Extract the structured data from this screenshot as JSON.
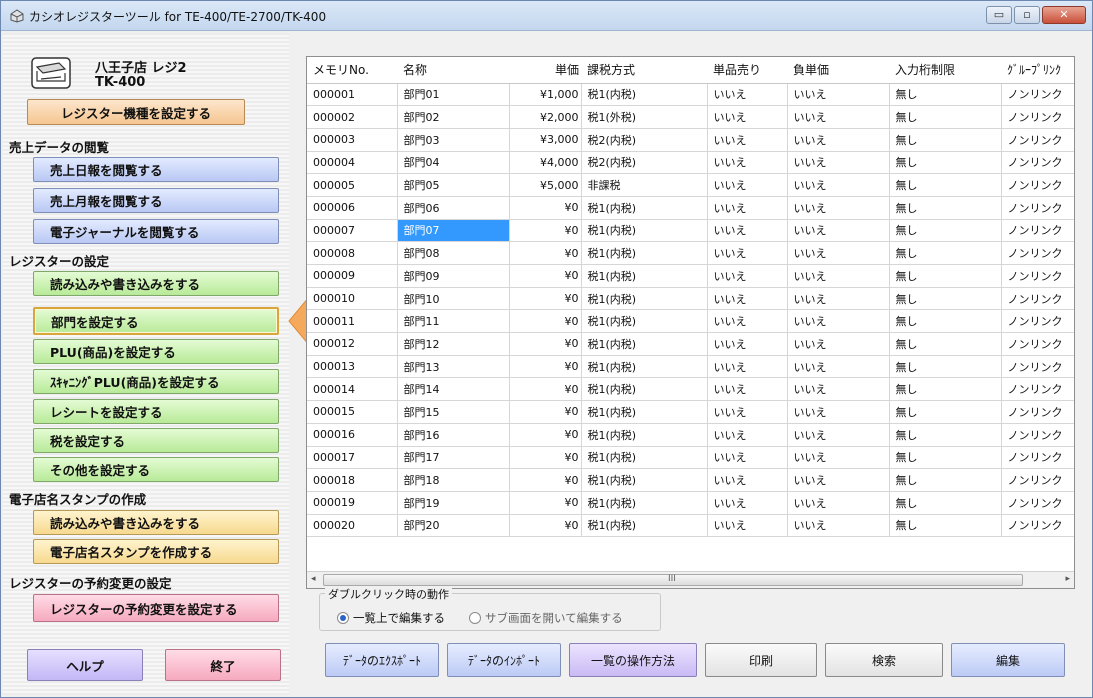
{
  "window": {
    "title": "カシオレジスターツール for TE-400/TE-2700/TK-400",
    "controls": {
      "minimize": "▭",
      "maximize": "▫",
      "close": "✕"
    }
  },
  "sidebar": {
    "register_name": "八王子店 レジ2",
    "register_model": "TK-400",
    "set_model_button": "レジスター機種を設定する",
    "sections": {
      "sales_view": {
        "title": "売上データの閲覧",
        "buttons": [
          "売上日報を閲覧する",
          "売上月報を閲覧する",
          "電子ジャーナルを閲覧する"
        ]
      },
      "register_settings": {
        "title": "レジスターの設定",
        "buttons": [
          "読み込みや書き込みをする",
          "部門を設定する",
          "PLU(商品)を設定する",
          "ｽｷｬﾆﾝｸﾞPLU(商品)を設定する",
          "レシートを設定する",
          "税を設定する",
          "その他を設定する"
        ],
        "selected_index": 1
      },
      "stamp": {
        "title": "電子店名スタンプの作成",
        "buttons": [
          "読み込みや書き込みをする",
          "電子店名スタンプを作成する"
        ]
      },
      "reservation": {
        "title": "レジスターの予約変更の設定",
        "buttons": [
          "レジスターの予約変更を設定する"
        ]
      }
    },
    "help_button": "ヘルプ",
    "exit_button": "終了"
  },
  "table": {
    "columns": [
      "メモリNo.",
      "名称",
      "単価",
      "課税方式",
      "単品売り",
      "負単価",
      "入力桁制限",
      "ｸﾞﾙｰﾌﾟﾘﾝｸ"
    ],
    "selected_cell": {
      "row": 6,
      "col": 1
    },
    "rows": [
      [
        "000001",
        "部門01",
        "¥1,000",
        "税1(内税)",
        "いいえ",
        "いいえ",
        "無し",
        "ノンリンク"
      ],
      [
        "000002",
        "部門02",
        "¥2,000",
        "税1(外税)",
        "いいえ",
        "いいえ",
        "無し",
        "ノンリンク"
      ],
      [
        "000003",
        "部門03",
        "¥3,000",
        "税2(内税)",
        "いいえ",
        "いいえ",
        "無し",
        "ノンリンク"
      ],
      [
        "000004",
        "部門04",
        "¥4,000",
        "税2(内税)",
        "いいえ",
        "いいえ",
        "無し",
        "ノンリンク"
      ],
      [
        "000005",
        "部門05",
        "¥5,000",
        "非課税",
        "いいえ",
        "いいえ",
        "無し",
        "ノンリンク"
      ],
      [
        "000006",
        "部門06",
        "¥0",
        "税1(内税)",
        "いいえ",
        "いいえ",
        "無し",
        "ノンリンク"
      ],
      [
        "000007",
        "部門07",
        "¥0",
        "税1(内税)",
        "いいえ",
        "いいえ",
        "無し",
        "ノンリンク"
      ],
      [
        "000008",
        "部門08",
        "¥0",
        "税1(内税)",
        "いいえ",
        "いいえ",
        "無し",
        "ノンリンク"
      ],
      [
        "000009",
        "部門09",
        "¥0",
        "税1(内税)",
        "いいえ",
        "いいえ",
        "無し",
        "ノンリンク"
      ],
      [
        "000010",
        "部門10",
        "¥0",
        "税1(内税)",
        "いいえ",
        "いいえ",
        "無し",
        "ノンリンク"
      ],
      [
        "000011",
        "部門11",
        "¥0",
        "税1(内税)",
        "いいえ",
        "いいえ",
        "無し",
        "ノンリンク"
      ],
      [
        "000012",
        "部門12",
        "¥0",
        "税1(内税)",
        "いいえ",
        "いいえ",
        "無し",
        "ノンリンク"
      ],
      [
        "000013",
        "部門13",
        "¥0",
        "税1(内税)",
        "いいえ",
        "いいえ",
        "無し",
        "ノンリンク"
      ],
      [
        "000014",
        "部門14",
        "¥0",
        "税1(内税)",
        "いいえ",
        "いいえ",
        "無し",
        "ノンリンク"
      ],
      [
        "000015",
        "部門15",
        "¥0",
        "税1(内税)",
        "いいえ",
        "いいえ",
        "無し",
        "ノンリンク"
      ],
      [
        "000016",
        "部門16",
        "¥0",
        "税1(内税)",
        "いいえ",
        "いいえ",
        "無し",
        "ノンリンク"
      ],
      [
        "000017",
        "部門17",
        "¥0",
        "税1(内税)",
        "いいえ",
        "いいえ",
        "無し",
        "ノンリンク"
      ],
      [
        "000018",
        "部門18",
        "¥0",
        "税1(内税)",
        "いいえ",
        "いいえ",
        "無し",
        "ノンリンク"
      ],
      [
        "000019",
        "部門19",
        "¥0",
        "税1(内税)",
        "いいえ",
        "いいえ",
        "無し",
        "ノンリンク"
      ],
      [
        "000020",
        "部門20",
        "¥0",
        "税1(内税)",
        "いいえ",
        "いいえ",
        "無し",
        "ノンリンク"
      ]
    ]
  },
  "scrollbar": {
    "left_arrow": "◂",
    "right_arrow": "▸",
    "grip": "III"
  },
  "double_click": {
    "legend": "ダブルクリック時の動作",
    "options": [
      "一覧上で編集する",
      "サブ画面を開いて編集する"
    ],
    "selected": 0
  },
  "toolbar": {
    "export": "ﾃﾞｰﾀのｴｸｽﾎﾟｰﾄ",
    "import": "ﾃﾞｰﾀのｲﾝﾎﾟｰﾄ",
    "how_to": "一覧の操作方法",
    "print": "印刷",
    "search": "検索",
    "edit": "編集"
  },
  "colors": {
    "selection": "#3399ff",
    "selected_border": "#d8a63a",
    "pointer": "#f5a95c"
  }
}
